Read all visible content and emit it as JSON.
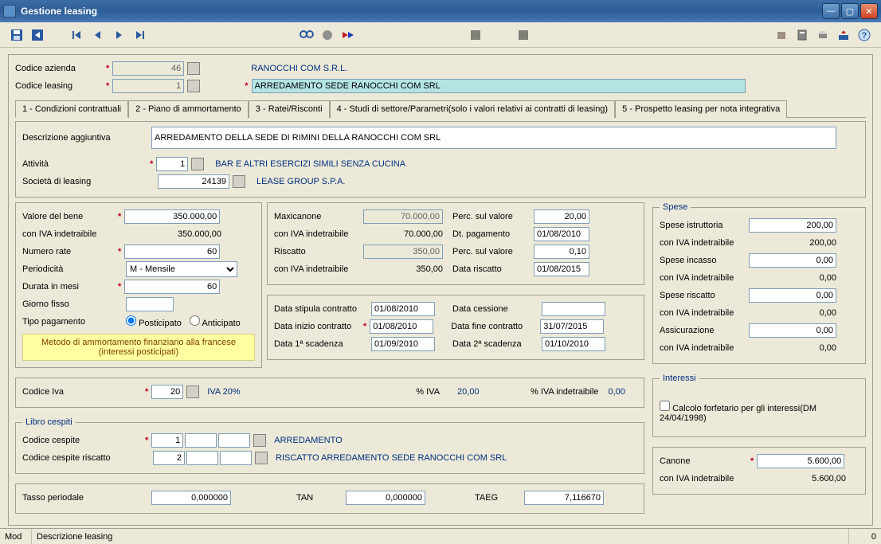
{
  "window": {
    "title": "Gestione leasing"
  },
  "header": {
    "codice_azienda_label": "Codice azienda",
    "codice_azienda_value": "46",
    "azienda_desc": "RANOCCHI COM S.R.L.",
    "codice_leasing_label": "Codice leasing",
    "codice_leasing_value": "1",
    "leasing_desc": "ARREDAMENTO SEDE RANOCCHI COM SRL"
  },
  "tabs": {
    "t1": "1 - Condizioni contrattuali",
    "t2": "2 - Piano di ammortamento",
    "t3": "3 - Ratei/Risconti",
    "t4": "4 - Studi di settore/Parametri(solo i valori relativi ai contratti di leasing)",
    "t5": "5 - Prospetto leasing per nota integrativa"
  },
  "desc": {
    "descrizione_aggiuntiva_label": "Descrizione aggiuntiva",
    "descrizione_aggiuntiva_value": "ARREDAMENTO DELLA SEDE DI RIMINI DELLA RANOCCHI COM SRL",
    "attivita_label": "Attività",
    "attivita_value": "1",
    "attivita_desc": "BAR E ALTRI ESERCIZI SIMILI SENZA CUCINA",
    "societa_label": "Società di leasing",
    "societa_value": "24139",
    "societa_desc": "LEASE GROUP S.P.A."
  },
  "left": {
    "valore_bene_label": "Valore del bene",
    "valore_bene": "350.000,00",
    "con_iva_label": "con IVA indetraibile",
    "con_iva": "350.000,00",
    "numero_rate_label": "Numero rate",
    "numero_rate": "60",
    "periodicita_label": "Periodicità",
    "periodicita": "M - Mensile",
    "durata_mesi_label": "Durata in mesi",
    "durata_mesi": "60",
    "giorno_fisso_label": "Giorno fisso",
    "giorno_fisso": "",
    "tipo_pagamento_label": "Tipo pagamento",
    "posticipato": "Posticipato",
    "anticipato": "Anticipato",
    "metodo_box_l1": "Metodo di ammortamento finanziario alla francese",
    "metodo_box_l2": "(interessi posticipati)"
  },
  "mid": {
    "maxicanone_label": "Maxicanone",
    "maxicanone": "70.000,00",
    "maxicanone_iva_label": "con IVA indetraibile",
    "maxicanone_iva": "70.000,00",
    "riscatto_label": "Riscatto",
    "riscatto": "350,00",
    "riscatto_iva_label": "con IVA indetraibile",
    "riscatto_iva": "350,00",
    "perc_valore_label": "Perc. sul valore",
    "perc_valore": "20,00",
    "dt_pagamento_label": "Dt. pagamento",
    "dt_pagamento": "01/08/2010",
    "perc_valore2_label": "Perc. sul valore",
    "perc_valore2": "0,10",
    "data_riscatto_label": "Data riscatto",
    "data_riscatto": "01/08/2015"
  },
  "dates": {
    "stipula_label": "Data stipula contratto",
    "stipula": "01/08/2010",
    "inizio_label": "Data inizio contratto",
    "inizio": "01/08/2010",
    "prima_scad_label": "Data 1ª scadenza",
    "prima_scad": "01/09/2010",
    "cessione_label": "Data cessione",
    "cessione": "",
    "fine_label": "Data fine contratto",
    "fine": "31/07/2015",
    "seconda_scad_label": "Data 2ª scadenza",
    "seconda_scad": "01/10/2010"
  },
  "spese": {
    "legend": "Spese",
    "istruttoria_label": "Spese istruttoria",
    "istruttoria": "200,00",
    "istruttoria_iva_label": "con IVA indetraibile",
    "istruttoria_iva": "200,00",
    "incasso_label": "Spese incasso",
    "incasso": "0,00",
    "incasso_iva_label": "con IVA indetraibile",
    "incasso_iva": "0,00",
    "riscatto_label": "Spese riscatto",
    "riscatto": "0,00",
    "riscatto_iva_label": "con IVA indetraibile",
    "riscatto_iva": "0,00",
    "assicurazione_label": "Assicurazione",
    "assicurazione": "0,00",
    "assicurazione_iva_label": "con IVA indetraibile",
    "assicurazione_iva": "0,00"
  },
  "iva": {
    "codice_iva_label": "Codice Iva",
    "codice_iva": "20",
    "iva_desc": "IVA 20%",
    "perc_iva_label": "% IVA",
    "perc_iva": "20,00",
    "perc_iva_ind_label": "% IVA indetraibile",
    "perc_iva_ind": "0,00"
  },
  "cespiti": {
    "legend": "Libro cespiti",
    "codice_label": "Codice cespite",
    "codice1": "1",
    "codice2": "",
    "codice3": "",
    "desc": "ARREDAMENTO",
    "riscatto_label": "Codice cespite riscatto",
    "riscatto1": "2",
    "riscatto2": "",
    "riscatto3": "",
    "riscatto_desc": "RISCATTO ARREDAMENTO SEDE RANOCCHI COM SRL"
  },
  "interessi": {
    "legend": "Interessi",
    "calcolo_label": "Calcolo forfetario per gli interessi(DM 24/04/1998)"
  },
  "tassi": {
    "tasso_periodale_label": "Tasso periodale",
    "tasso_periodale": "0,000000",
    "tan_label": "TAN",
    "tan": "0,000000",
    "taeg_label": "TAEG",
    "taeg": "7,116670"
  },
  "canone": {
    "canone_label": "Canone",
    "canone": "5.600,00",
    "canone_iva_label": "con IVA indetraibile",
    "canone_iva": "5.600,00"
  },
  "status": {
    "mode": "Mod",
    "desc": "Descrizione leasing",
    "right": "0"
  }
}
